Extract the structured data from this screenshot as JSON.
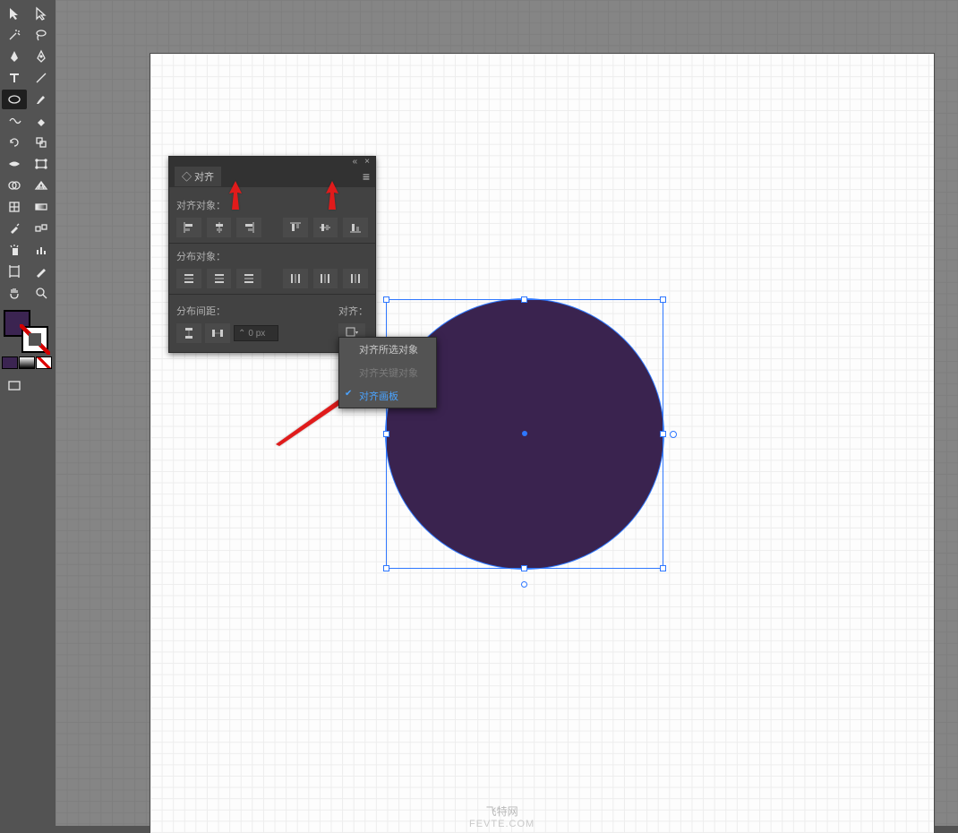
{
  "panel": {
    "tab_label": "◇ 对齐",
    "section_align": "对齐对象：",
    "section_dist": "分布对象：",
    "section_spacing": "分布间距：",
    "align_to_label": "对齐：",
    "spacing_value": "0 px"
  },
  "dropdown": {
    "opt_selection": "对齐所选对象",
    "opt_key": "对齐关键对象",
    "opt_artboard": "对齐画板"
  },
  "watermark": {
    "l1": "飞特网",
    "l2": "FEVTE.COM"
  },
  "colors": {
    "fill": "#3b2451"
  }
}
